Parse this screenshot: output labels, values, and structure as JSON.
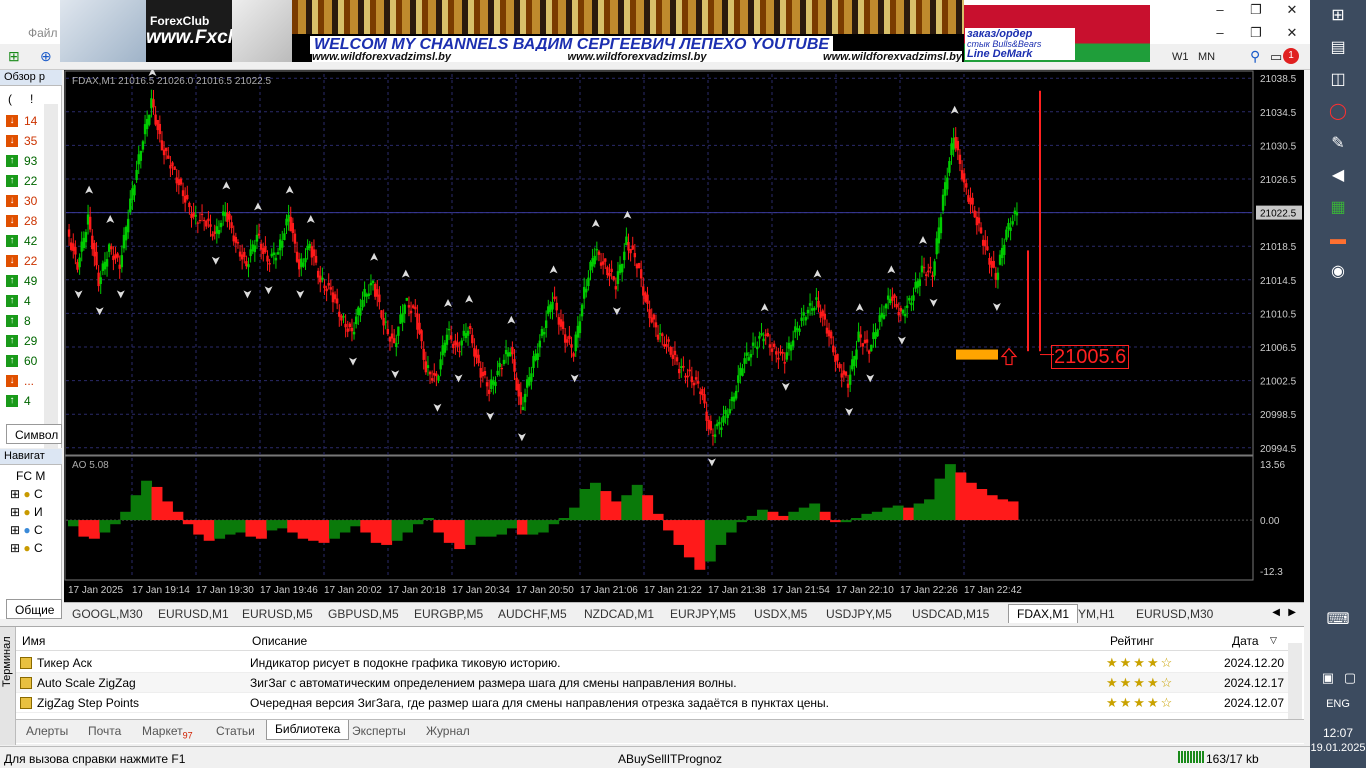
{
  "menubar": {
    "file_label": "Файл"
  },
  "banner": {
    "forex_label": "ForexClub",
    "site": "www.Fxclub.by",
    "welcome": "WELCOM MY CHANNELS ВАДИМ СЕРГЕЕВИЧ ЛЕПЕХО YOUTUBE",
    "urls": [
      "www.wildforexvadzimsl.by",
      "www.wildforexvadzimsl.by",
      "www.wildforexvadzimsl.by"
    ],
    "right_line1": "заказ/ордер",
    "right_line2": "стык Bulls&Bears",
    "right_line3": "Line DeMark"
  },
  "toolbar": {
    "timeframes": [
      "W1",
      "MN"
    ],
    "notification_count": "1"
  },
  "market_watch": {
    "title": "Обзор р",
    "header_left": "(",
    "header_right": "!",
    "rows": [
      {
        "dir": "down",
        "value": "14",
        "color": "#cc3300"
      },
      {
        "dir": "down",
        "value": "35",
        "color": "#cc3300"
      },
      {
        "dir": "up",
        "value": "93",
        "color": "#006600"
      },
      {
        "dir": "up",
        "value": "22",
        "color": "#006600"
      },
      {
        "dir": "down",
        "value": "30",
        "color": "#cc3300"
      },
      {
        "dir": "down",
        "value": "28",
        "color": "#cc3300"
      },
      {
        "dir": "up",
        "value": "42",
        "color": "#006600"
      },
      {
        "dir": "down",
        "value": "22",
        "color": "#cc3300"
      },
      {
        "dir": "up",
        "value": "49",
        "color": "#006600"
      },
      {
        "dir": "up",
        "value": "4",
        "color": "#006600"
      },
      {
        "dir": "up",
        "value": "8",
        "color": "#006600"
      },
      {
        "dir": "up",
        "value": "29",
        "color": "#006600"
      },
      {
        "dir": "up",
        "value": "60",
        "color": "#006600"
      },
      {
        "dir": "down",
        "value": "...",
        "color": "#cc3300"
      },
      {
        "dir": "up",
        "value": "4",
        "color": "#006600"
      }
    ],
    "tab_label": "Символ"
  },
  "navigator": {
    "title": "Навигат",
    "root": "FC M",
    "items": [
      "С",
      "И",
      "С",
      "С"
    ],
    "tab_label": "Общие"
  },
  "chart": {
    "info": "FDAX,M1  21016.5 21026.0 21016.5 21022.5",
    "ao_info": "AO 5.08",
    "current_price_label": "21005.6",
    "colors": {
      "bull": "#00cc00",
      "bear": "#ff1a1a",
      "ao_up": "#0a7a0a",
      "ao_down": "#ff1a1a",
      "grid": "#2a2a6a",
      "orange": "#ffa500"
    }
  },
  "chart_data": {
    "type": "candlestick",
    "symbol": "FDAX",
    "timeframe": "M1",
    "price_ticks": [
      "21038.5",
      "21034.5",
      "21030.5",
      "21026.5",
      "21022.5",
      "21018.5",
      "21014.5",
      "21010.5",
      "21006.5",
      "21002.5",
      "20998.5",
      "20994.5"
    ],
    "current_price_tag": "21022.5",
    "ylim": [
      20994.0,
      21039.0
    ],
    "ao_ticks": [
      "13.56",
      "0.00",
      "-12.3"
    ],
    "ao_ylim": [
      -13.5,
      14.5
    ],
    "time_labels": [
      "17 Jan 2025",
      "17 Jan 19:14",
      "17 Jan 19:30",
      "17 Jan 19:46",
      "17 Jan 20:02",
      "17 Jan 20:18",
      "17 Jan 20:34",
      "17 Jan 20:50",
      "17 Jan 21:06",
      "17 Jan 21:22",
      "17 Jan 21:38",
      "17 Jan 21:54",
      "17 Jan 22:10",
      "17 Jan 22:26",
      "17 Jan 22:42"
    ],
    "close_path": [
      21020.5,
      21016.0,
      21022.0,
      21014.0,
      21018.5,
      21016.0,
      21024.0,
      21030.0,
      21036.0,
      21030.0,
      21028.0,
      21024.5,
      21022.0,
      21021.5,
      21020.0,
      21022.5,
      21019.0,
      21016.0,
      21020.0,
      21016.5,
      21018.0,
      21022.0,
      21016.0,
      21018.5,
      21014.5,
      21013.0,
      21010.0,
      21008.0,
      21012.5,
      21014.0,
      21009.5,
      21006.5,
      21012.0,
      21010.5,
      21004.0,
      21002.5,
      21008.5,
      21006.0,
      21009.0,
      21004.0,
      21001.5,
      21004.0,
      21006.5,
      20999.0,
      21004.0,
      21008.0,
      21012.5,
      21008.0,
      21006.0,
      21013.0,
      21018.0,
      21016.0,
      21014.0,
      21019.0,
      21016.5,
      21011.0,
      21008.0,
      21006.5,
      21004.0,
      21003.0,
      21001.5,
      20996.0,
      20997.5,
      21000.0,
      21004.5,
      21006.5,
      21008.0,
      21006.0,
      21005.0,
      21008.5,
      21010.5,
      21012.0,
      21008.5,
      21004.5,
      21002.0,
      21008.0,
      21006.0,
      21010.0,
      21012.5,
      21010.5,
      21012.0,
      21016.0,
      21015.0,
      21024.5,
      21031.5,
      21026.0,
      21022.0,
      21018.5,
      21014.5,
      21020.5,
      21022.5
    ],
    "ao_values": [
      -1.5,
      -4.0,
      -4.5,
      -3.0,
      -1.0,
      2.0,
      6.0,
      9.5,
      8.0,
      4.5,
      2.0,
      -1.0,
      -3.5,
      -5.0,
      -4.5,
      -3.5,
      -3.0,
      -4.0,
      -4.5,
      -2.5,
      -2.0,
      -3.0,
      -4.5,
      -5.0,
      -5.5,
      -4.5,
      -3.0,
      -1.5,
      -3.0,
      -5.5,
      -6.0,
      -5.0,
      -3.0,
      -1.0,
      0.5,
      -3.0,
      -5.5,
      -7.0,
      -6.0,
      -4.0,
      -4.0,
      -3.5,
      -2.0,
      -3.5,
      -3.5,
      -3.0,
      -1.0,
      0.5,
      3.0,
      7.5,
      9.0,
      7.0,
      4.5,
      6.0,
      8.5,
      6.0,
      1.5,
      -2.5,
      -6.0,
      -9.0,
      -12.0,
      -10.0,
      -6.0,
      -3.0,
      -0.5,
      1.0,
      2.5,
      2.0,
      1.0,
      2.0,
      3.0,
      4.0,
      2.0,
      -0.5,
      -0.5,
      0.5,
      1.5,
      2.0,
      3.0,
      3.5,
      3.0,
      4.0,
      5.0,
      10.0,
      13.5,
      11.5,
      9.0,
      7.5,
      6.0,
      5.0,
      4.5
    ],
    "current_price": 21005.6,
    "orange_zone": [
      21005.0,
      21006.2
    ]
  },
  "chart_tabs": {
    "tabs": [
      "GOOGL,M30",
      "EURUSD,M1",
      "EURUSD,M5",
      "GBPUSD,M5",
      "EURGBP,M5",
      "AUDCHF,M5",
      "NZDCAD,M1",
      "EURJPY,M5",
      "USDX,M5",
      "USDJPY,M5",
      "USDCAD,M15",
      "FDAX,M1",
      "YM,H1",
      "EURUSD,M30"
    ],
    "active": "FDAX,M1"
  },
  "terminal": {
    "side_label": "Терминал",
    "columns": {
      "name": "Имя",
      "description": "Описание",
      "rating": "Рейтинг",
      "date": "Дата"
    },
    "rows": [
      {
        "name": "Тикер Аск",
        "description": "Индикатор рисует в подокне графика тиковую историю.",
        "stars": "★★★★☆",
        "date": "2024.12.20"
      },
      {
        "name": "Auto Scale ZigZag",
        "description": "ЗигЗаг с автоматическим определением размера шага для смены направления волны.",
        "stars": "★★★★☆",
        "date": "2024.12.17"
      },
      {
        "name": "ZigZag Step Points",
        "description": "Очередная версия ЗигЗага, где размер шага для смены направления отрезка задаётся в пунктах цены.",
        "stars": "★★★★☆",
        "date": "2024.12.07"
      }
    ],
    "tabs": [
      "Алерты",
      "Почта",
      "Маркет",
      "Статьи",
      "Библиотека",
      "Эксперты",
      "Журнал"
    ],
    "market_badge": "97",
    "active_tab": "Библиотека"
  },
  "status": {
    "help": "Для вызова справки нажмите F1",
    "profile": "ABuySellITPrognoz",
    "traffic": "163/17 kb"
  },
  "taskbar": {
    "lang": "ENG",
    "time": "12:07",
    "date": "19.01.2025"
  }
}
